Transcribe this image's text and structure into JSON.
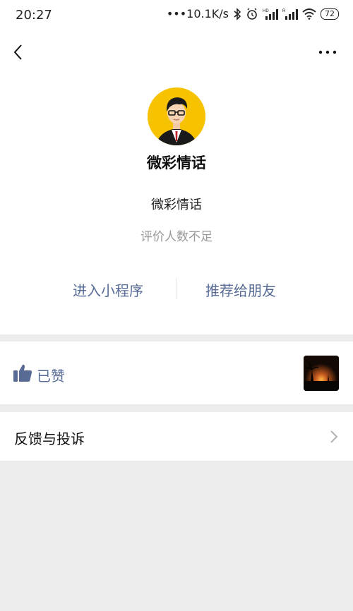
{
  "status_bar": {
    "time": "20:27",
    "network_speed": "•••10.1K/s",
    "battery": "72",
    "icons": [
      "bluetooth-icon",
      "alarm-icon",
      "signal-hd-icon",
      "signal-r-icon",
      "wifi-icon",
      "battery-icon"
    ]
  },
  "nav": {
    "back_icon": "chevron-left-icon",
    "more_icon": "more-dots-icon"
  },
  "profile": {
    "name": "微彩情话",
    "description": "微彩情话",
    "rating": "评价人数不足",
    "avatar_bg": "#f7c300"
  },
  "actions": {
    "enter": "进入小程序",
    "recommend": "推荐给朋友"
  },
  "likes": {
    "label": "已赞",
    "icon": "thumbs-up-icon"
  },
  "feedback": {
    "label": "反馈与投诉",
    "icon": "chevron-right-icon"
  },
  "colors": {
    "link": "#576b95",
    "background": "#ededed"
  }
}
